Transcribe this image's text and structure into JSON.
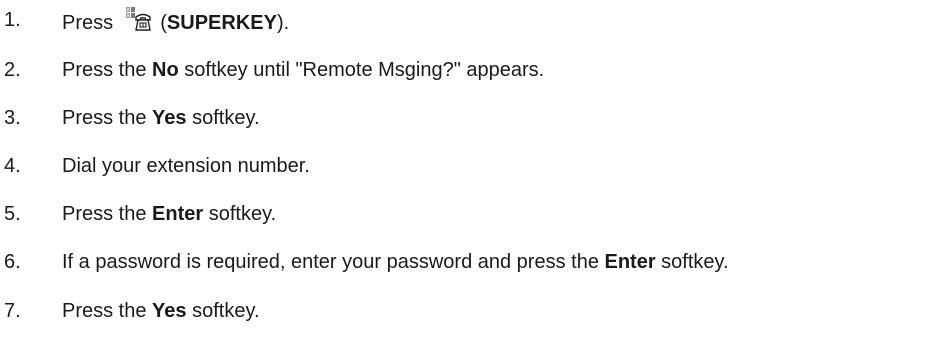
{
  "steps": [
    {
      "number": "1.",
      "before": "Press ",
      "icon": "superkey-phone-icon",
      "paren_open": " (",
      "bold": "SUPERKEY",
      "after": ")."
    },
    {
      "number": "2.",
      "before": "Press the ",
      "bold": "No",
      "after": " softkey until \"Remote Msging?\" appears."
    },
    {
      "number": "3.",
      "before": "Press the ",
      "bold": "Yes",
      "after": " softkey."
    },
    {
      "number": "4.",
      "text": "Dial your extension number."
    },
    {
      "number": "5.",
      "before": "Press the ",
      "bold": "Enter",
      "after": " softkey."
    },
    {
      "number": "6.",
      "before": "If a password is required, enter your password and press the ",
      "bold": "Enter",
      "after": " softkey."
    },
    {
      "number": "7.",
      "before": "Press the ",
      "bold": "Yes",
      "after": " softkey."
    }
  ]
}
